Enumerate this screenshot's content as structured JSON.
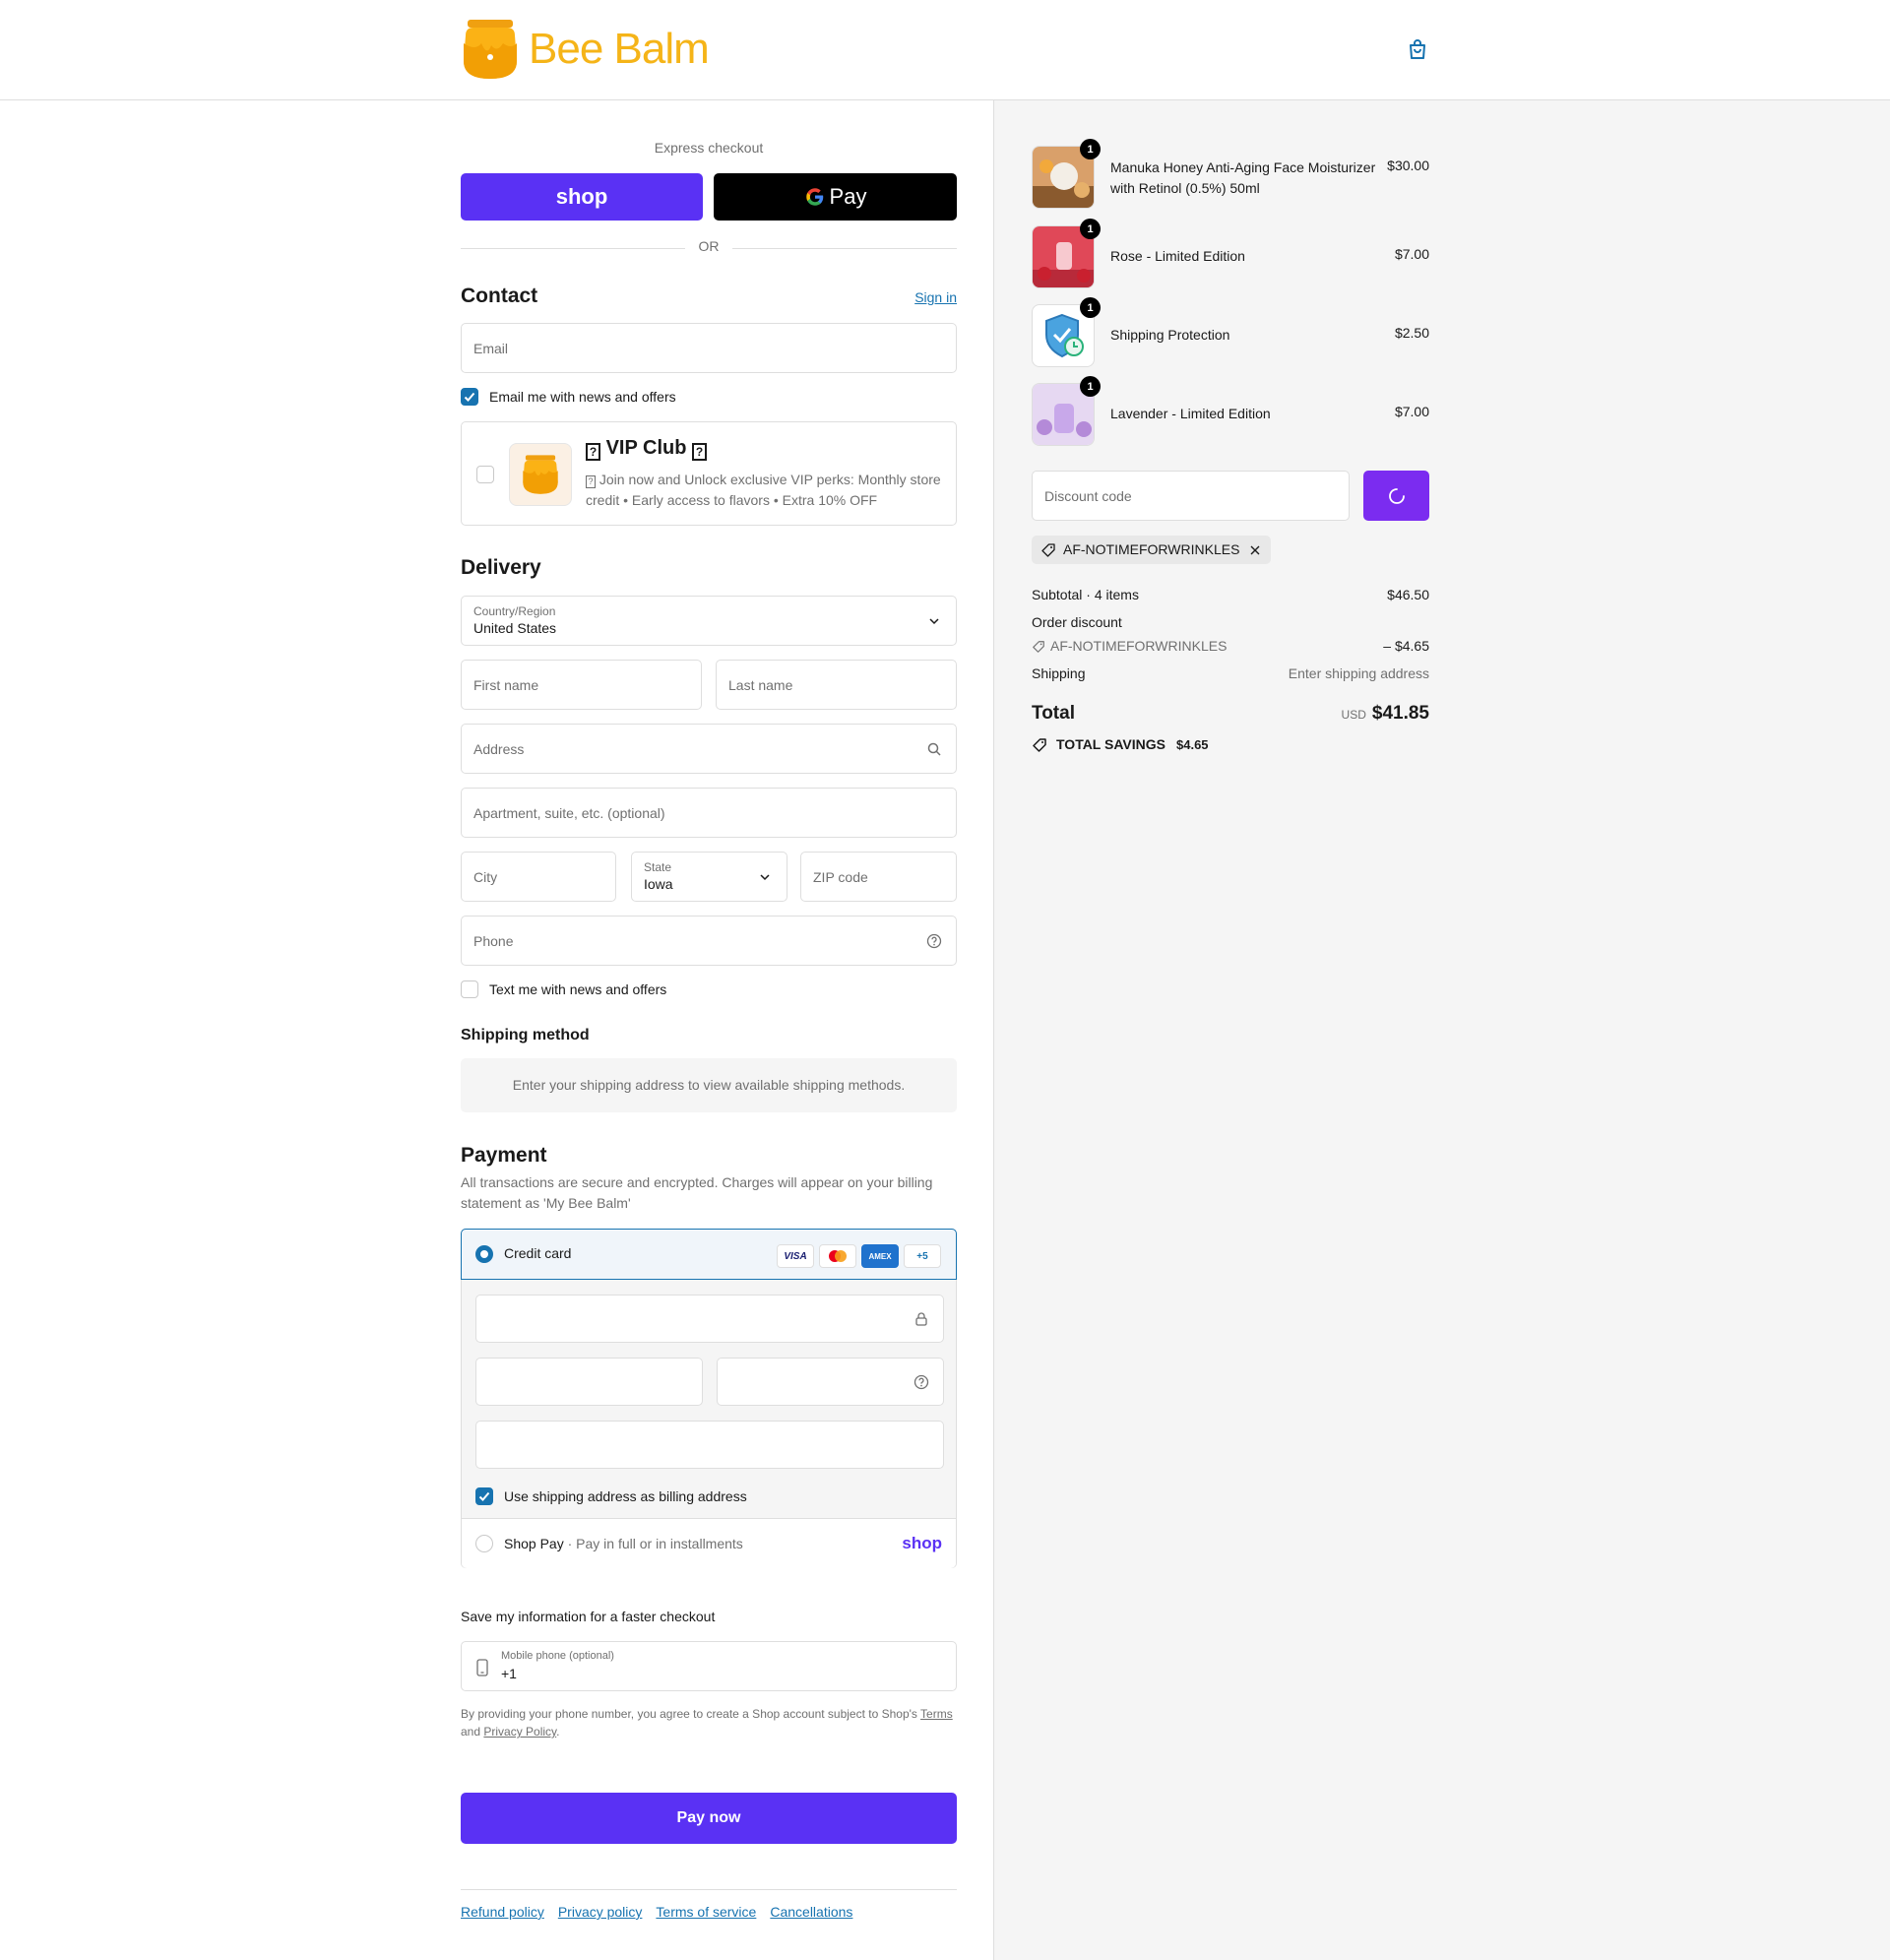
{
  "header": {
    "logo_text": "Bee Balm",
    "cart_icon": "shopping-bag-icon"
  },
  "express": {
    "label": "Express checkout",
    "shop_pay_label": "shop",
    "gpay_label": "Pay",
    "or_label": "OR"
  },
  "contact": {
    "title": "Contact",
    "sign_in": "Sign in",
    "email_placeholder": "Email",
    "email_news_label": "Email me with news and offers",
    "email_news_checked": true
  },
  "vip": {
    "title": "VIP Club",
    "description": "Join now and Unlock exclusive VIP perks: Monthly store credit • Early access to flavors • Extra 10% OFF"
  },
  "delivery": {
    "title": "Delivery",
    "country_label": "Country/Region",
    "country_value": "United States",
    "first_name_placeholder": "First name",
    "last_name_placeholder": "Last name",
    "address_placeholder": "Address",
    "apartment_placeholder": "Apartment, suite, etc. (optional)",
    "city_placeholder": "City",
    "state_label": "State",
    "state_value": "Iowa",
    "zip_placeholder": "ZIP code",
    "phone_placeholder": "Phone",
    "text_news_label": "Text me with news and offers"
  },
  "shipping_method": {
    "title": "Shipping method",
    "info": "Enter your shipping address to view available shipping methods."
  },
  "payment": {
    "title": "Payment",
    "subtitle": "All transactions are secure and encrypted. Charges will appear on your billing statement as 'My Bee Balm'",
    "credit_card_label": "Credit card",
    "card_badges": [
      "VISA",
      "",
      "AMEX",
      "+5"
    ],
    "billing_same_label": "Use shipping address as billing address",
    "shop_pay_label": "Shop Pay",
    "shop_pay_sub": "Pay in full or in installments",
    "shop_pay_logo": "shop"
  },
  "save_info": {
    "title": "Save my information for a faster checkout",
    "mobile_label": "Mobile phone (optional)",
    "mobile_value": "+1",
    "disclaimer_pre": "By providing your phone number, you agree to create a Shop account subject to Shop's",
    "terms": "Terms",
    "and": "and",
    "privacy": "Privacy Policy",
    "period": "."
  },
  "pay_now": "Pay now",
  "footer_links": [
    "Refund policy",
    "Privacy policy",
    "Terms of service",
    "Cancellations"
  ],
  "order": {
    "items": [
      {
        "qty": "1",
        "name": "Manuka Honey Anti-Aging Face Moisturizer with Retinol (0.5%) 50ml",
        "price": "$30.00"
      },
      {
        "qty": "1",
        "name": "Rose - Limited Edition",
        "price": "$7.00"
      },
      {
        "qty": "1",
        "name": "Shipping Protection",
        "price": "$2.50"
      },
      {
        "qty": "1",
        "name": "Lavender - Limited Edition",
        "price": "$7.00"
      }
    ],
    "discount_placeholder": "Discount code",
    "applied_code": "AF-NOTIMEFORWRINKLES",
    "subtotal_label": "Subtotal · 4 items",
    "subtotal_value": "$46.50",
    "order_discount_label": "Order discount",
    "discount_code": "AF-NOTIMEFORWRINKLES",
    "discount_value": "– $4.65",
    "shipping_label": "Shipping",
    "shipping_value": "Enter shipping address",
    "total_label": "Total",
    "currency": "USD",
    "total_value": "$41.85",
    "savings_label": "TOTAL SAVINGS",
    "savings_value": "$4.65"
  },
  "colors": {
    "accent": "#5a31f4",
    "link": "#1773b0",
    "discount_btn": "#7b2cf0",
    "logo": "#f5b418"
  }
}
